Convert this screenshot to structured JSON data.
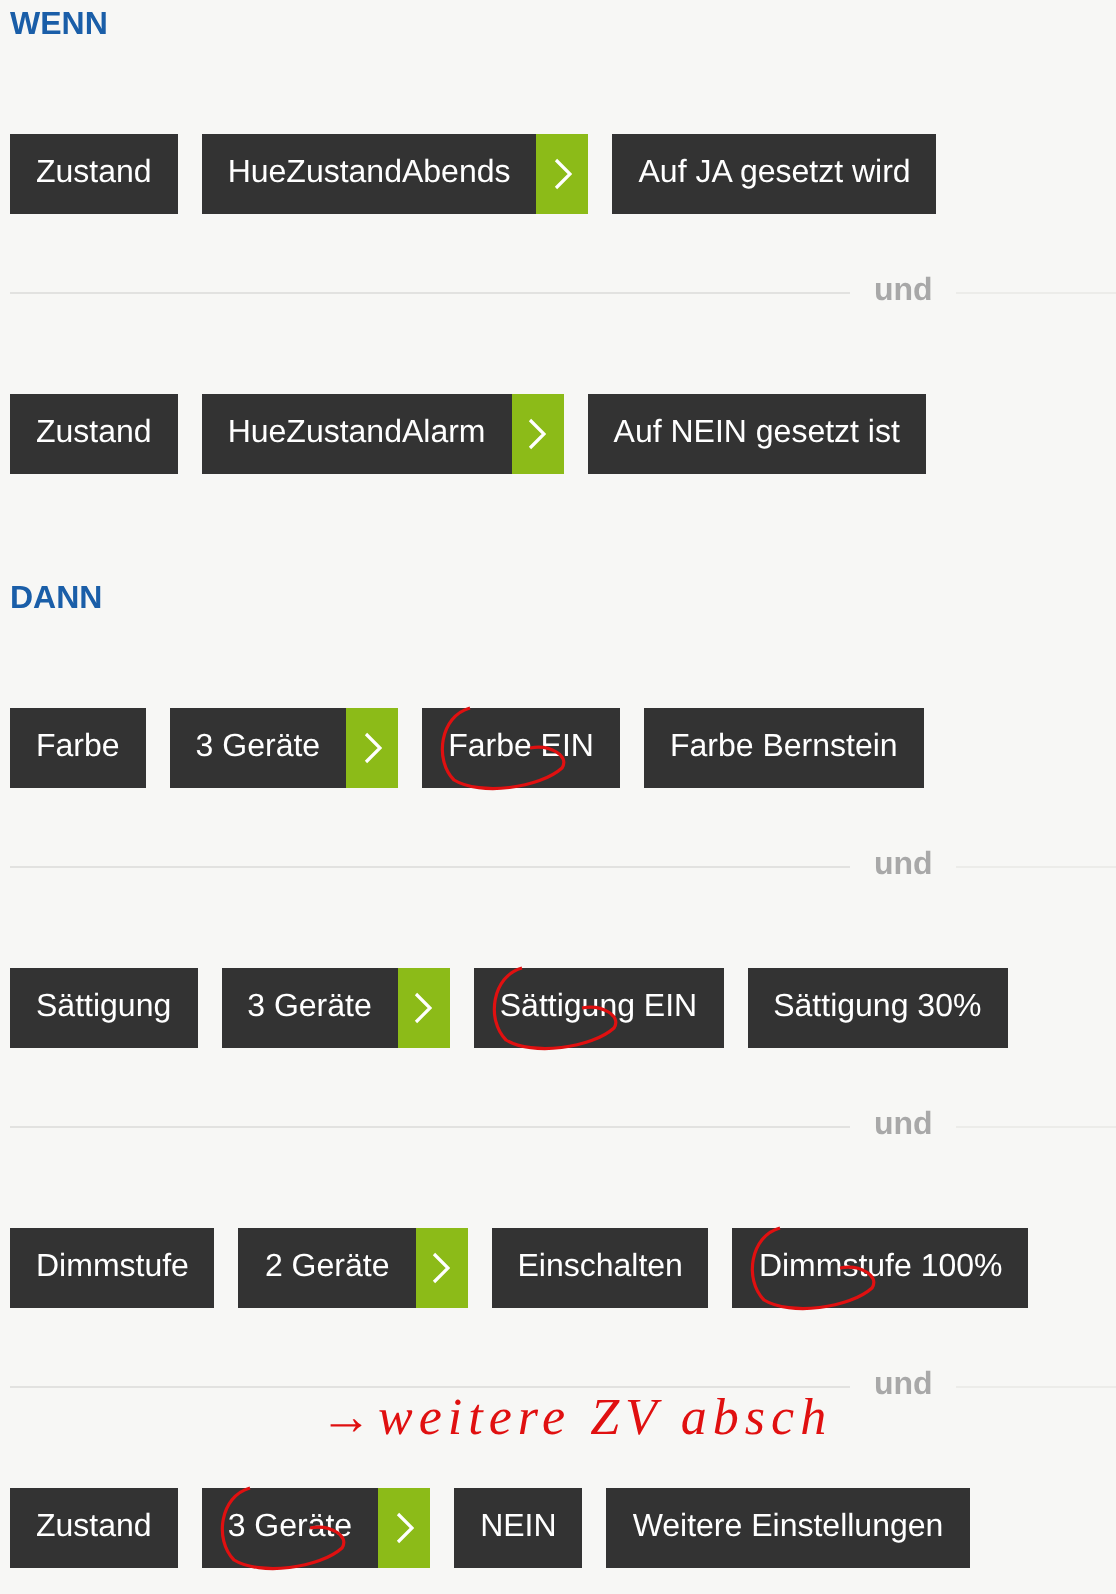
{
  "sections": [
    {
      "title": "WENN",
      "rules": [
        {
          "chips": [
            {
              "kind": "plain",
              "label": "Zustand",
              "circled": false
            },
            {
              "kind": "devices",
              "label": "HueZustandAbends",
              "circled": false
            },
            {
              "kind": "plain",
              "label": "Auf JA gesetzt wird",
              "circled": false
            }
          ]
        },
        {
          "connector": "und",
          "chips": [
            {
              "kind": "plain",
              "label": "Zustand",
              "circled": false
            },
            {
              "kind": "devices",
              "label": "HueZustandAlarm",
              "circled": false
            },
            {
              "kind": "plain",
              "label": "Auf NEIN gesetzt ist",
              "circled": false
            }
          ]
        }
      ]
    },
    {
      "title": "DANN",
      "rules": [
        {
          "chips": [
            {
              "kind": "plain",
              "label": "Farbe",
              "circled": false
            },
            {
              "kind": "devices",
              "label": "3 Geräte",
              "circled": false
            },
            {
              "kind": "plain",
              "label": "Farbe EIN",
              "circled": true
            },
            {
              "kind": "plain",
              "label": "Farbe Bernstein",
              "circled": false
            }
          ]
        },
        {
          "connector": "und",
          "chips": [
            {
              "kind": "plain",
              "label": "Sättigung",
              "circled": false
            },
            {
              "kind": "devices",
              "label": "3 Geräte",
              "circled": false
            },
            {
              "kind": "plain",
              "label": "Sättigung EIN",
              "circled": true
            },
            {
              "kind": "plain",
              "label": "Sättigung 30%",
              "circled": false
            }
          ]
        },
        {
          "connector": "und",
          "chips": [
            {
              "kind": "plain",
              "label": "Dimmstufe",
              "circled": false
            },
            {
              "kind": "devices",
              "label": "2 Geräte",
              "circled": false
            },
            {
              "kind": "plain",
              "label": "Einschalten",
              "circled": false
            },
            {
              "kind": "plain",
              "label": "Dimmstufe 100%",
              "circled": true
            }
          ]
        },
        {
          "connector": "und",
          "note": "→weitere ZV absch",
          "chips": [
            {
              "kind": "plain",
              "label": "Zustand",
              "circled": false
            },
            {
              "kind": "devices",
              "label": "3 Geräte",
              "circled": true
            },
            {
              "kind": "plain",
              "label": "NEIN",
              "circled": false
            },
            {
              "kind": "plain",
              "label": "Weitere Einstellungen",
              "circled": false
            }
          ]
        }
      ]
    }
  ]
}
